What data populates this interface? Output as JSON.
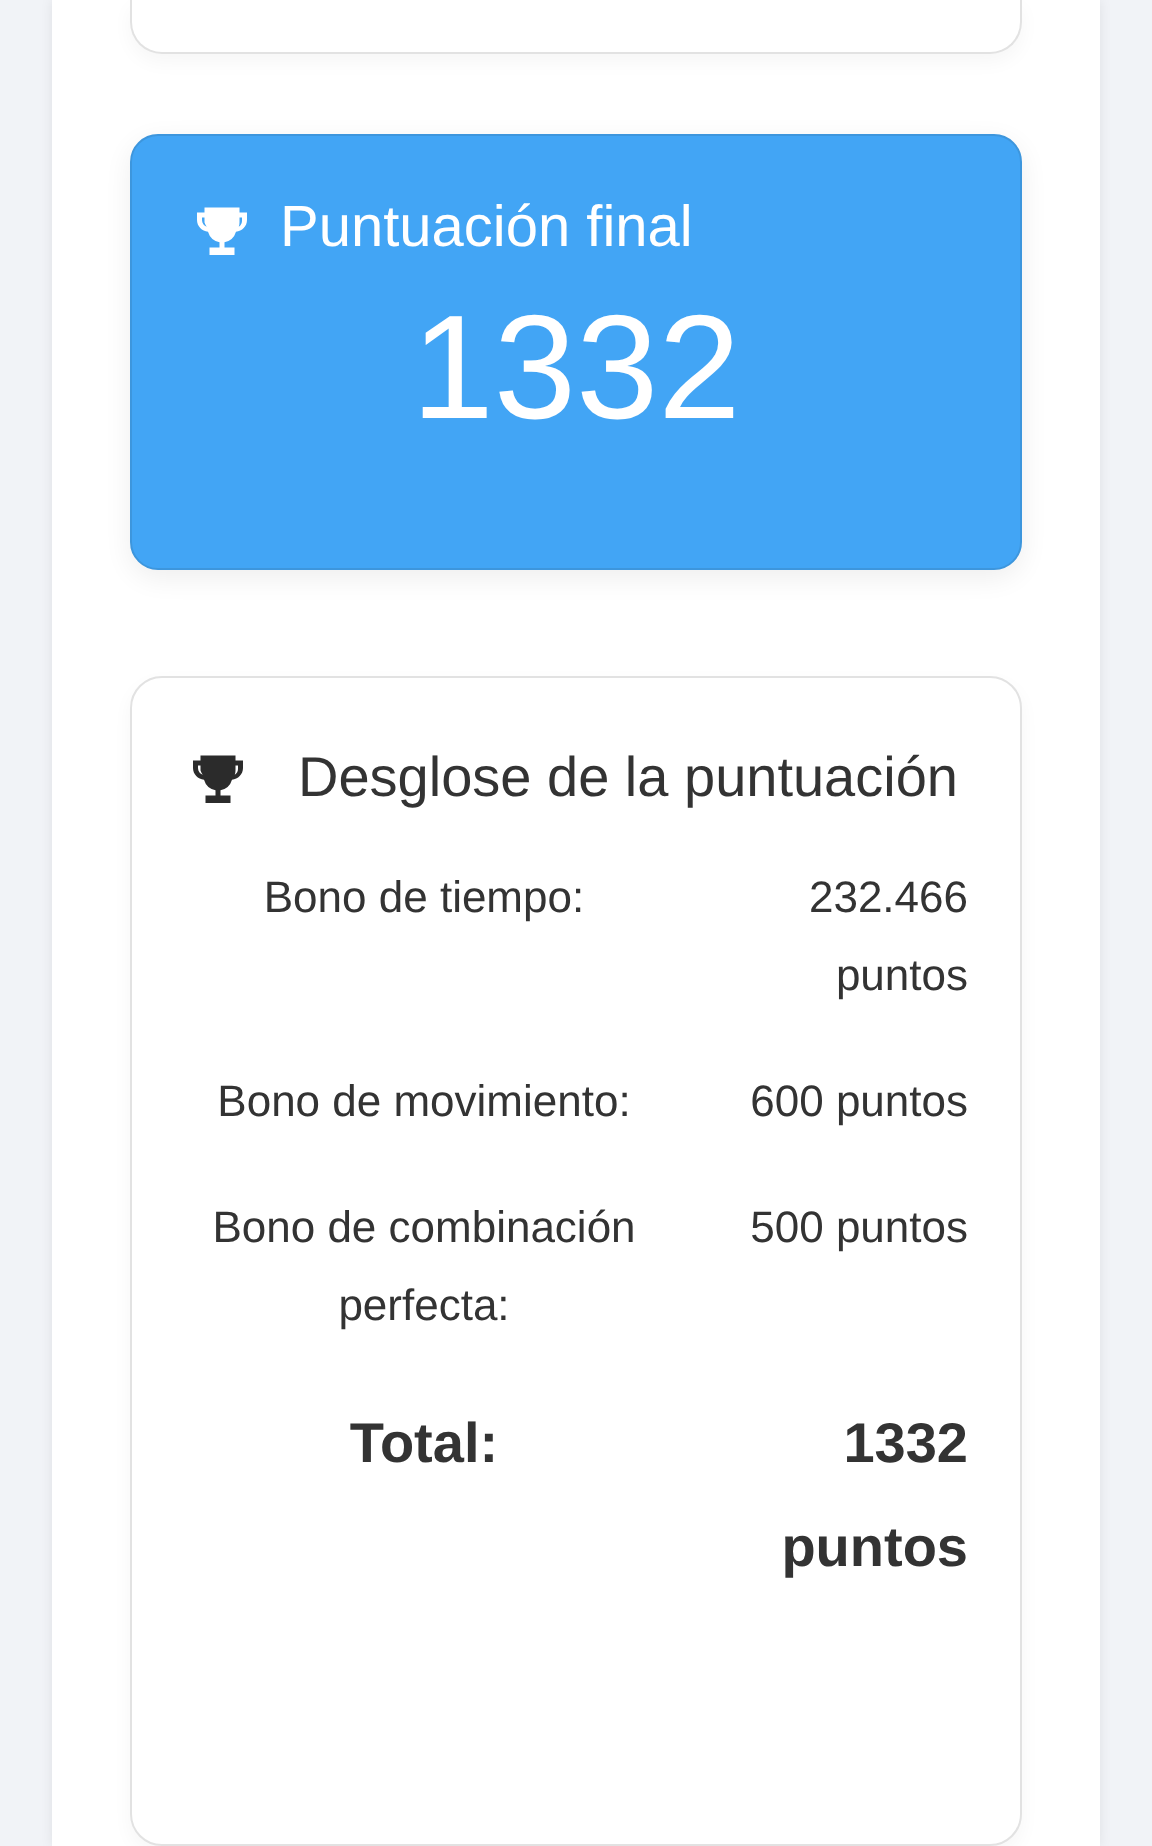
{
  "final_score": {
    "title": "Puntuación final",
    "value": "1332"
  },
  "breakdown": {
    "title": "Desglose de la puntuación",
    "rows": [
      {
        "kind": "item",
        "label": "Bono de tiempo:",
        "value": "232.466 puntos"
      },
      {
        "kind": "item",
        "label": "Bono de movimiento:",
        "value": "600 puntos"
      },
      {
        "kind": "item",
        "label": "Bono de combinación perfecta:",
        "value": "500 puntos"
      },
      {
        "kind": "total",
        "label": "Total:",
        "value": "1332 puntos"
      }
    ]
  }
}
